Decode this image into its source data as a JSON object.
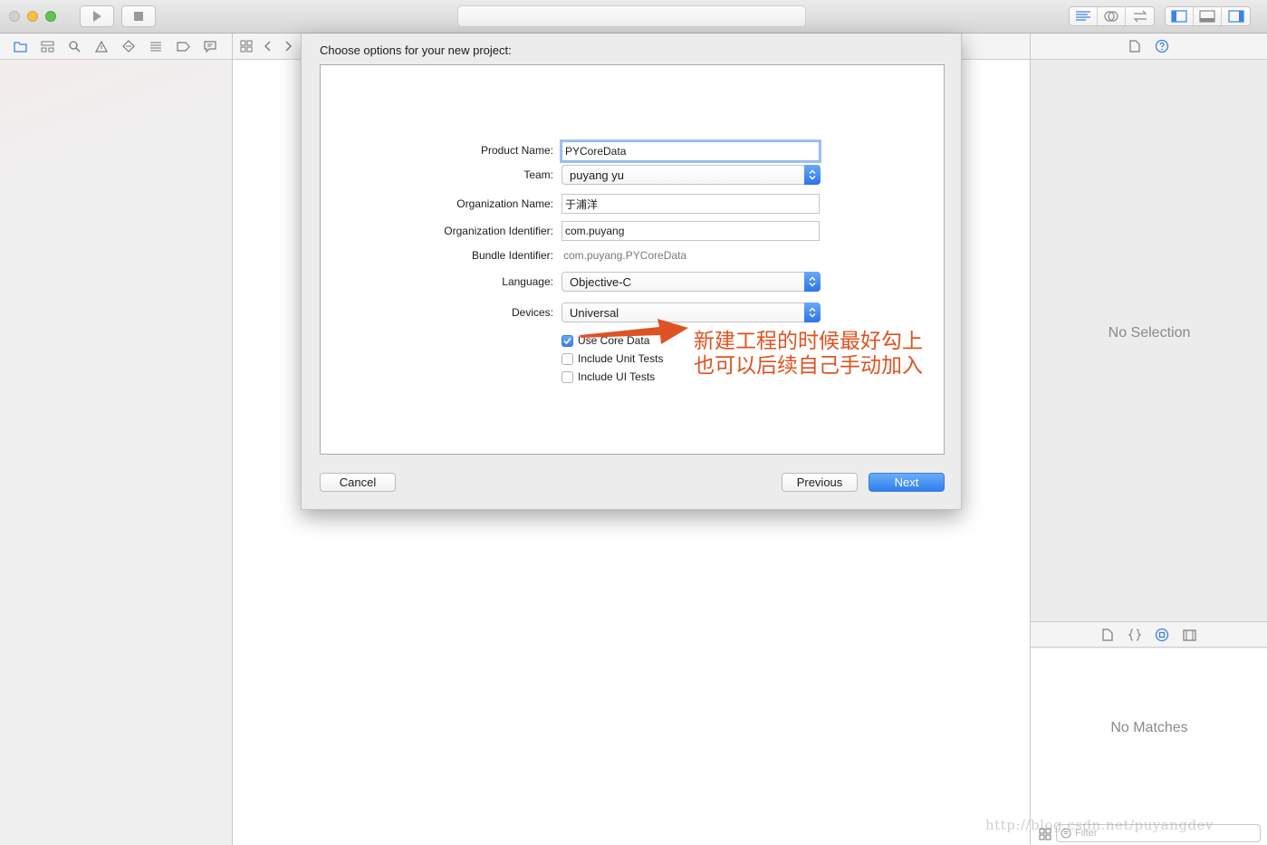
{
  "toolbar": {
    "icons": [
      "play-icon",
      "stop-icon",
      "standard-editor-icon",
      "assistant-editor-icon",
      "version-editor-icon",
      "left-panel-icon",
      "bottom-panel-icon",
      "right-panel-icon"
    ]
  },
  "navigator": {
    "tabs": [
      "project-navigator-icon",
      "symbol-navigator-icon",
      "find-navigator-icon",
      "issue-navigator-icon",
      "test-navigator-icon",
      "debug-navigator-icon",
      "breakpoint-navigator-icon",
      "report-navigator-icon"
    ],
    "selected_tab": "project-navigator-icon",
    "accent": "#3c82e6"
  },
  "dialog": {
    "title": "Choose options for your new project:",
    "fields": {
      "product_name": {
        "label": "Product Name:",
        "value": "PYCoreData"
      },
      "team": {
        "label": "Team:",
        "value": "puyang yu"
      },
      "organization_name": {
        "label": "Organization Name:",
        "value": "于浦洋"
      },
      "organization_identifier": {
        "label": "Organization Identifier:",
        "value": "com.puyang"
      },
      "bundle_identifier": {
        "label": "Bundle Identifier:",
        "value": "com.puyang.PYCoreData"
      },
      "language": {
        "label": "Language:",
        "value": "Objective-C"
      },
      "devices": {
        "label": "Devices:",
        "value": "Universal"
      }
    },
    "options": [
      {
        "label": "Use Core Data",
        "checked": true
      },
      {
        "label": "Include Unit Tests",
        "checked": false
      },
      {
        "label": "Include UI Tests",
        "checked": false
      }
    ],
    "annotation": {
      "line1": "新建工程的时候最好勾上",
      "line2": "也可以后续自己手动加入",
      "color": "#de5321"
    },
    "buttons": {
      "cancel": "Cancel",
      "previous": "Previous",
      "next": "Next"
    }
  },
  "inspector": {
    "tabs": [
      "file-inspector-icon",
      "quick-help-icon"
    ],
    "empty_text": "No Selection",
    "library_tabs": [
      "file-template-icon",
      "code-snippet-icon",
      "object-library-icon",
      "media-library-icon"
    ],
    "library_empty_text": "No Matches",
    "filter_placeholder": "Filter"
  },
  "watermark": "http://blog.csdn.net/puyangdev"
}
